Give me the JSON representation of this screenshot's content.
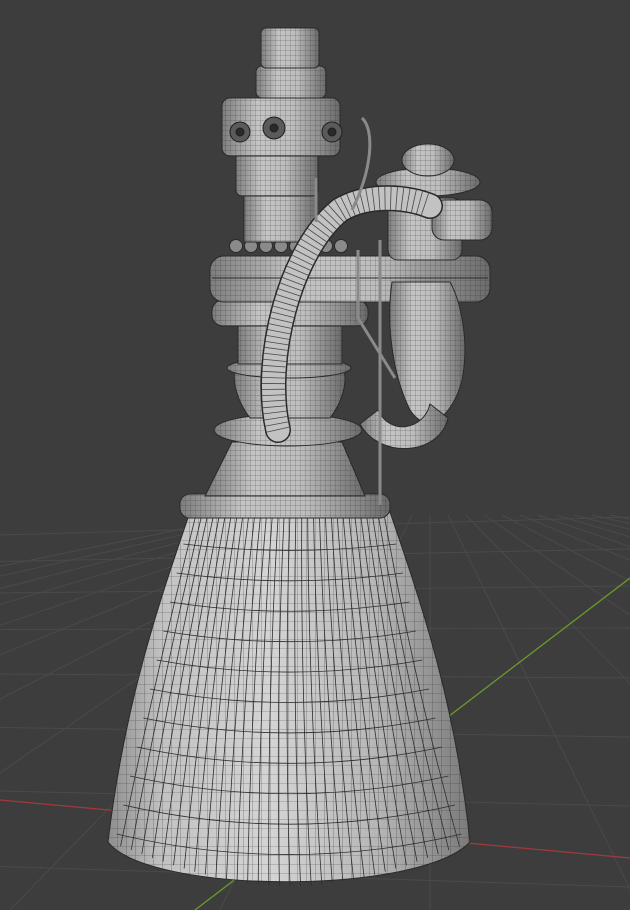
{
  "viewport": {
    "background": "#3d3d3d",
    "grid_color": "#4a4a4a",
    "x_axis_color": "#a33a3a",
    "y_axis_color": "#6b9a2a",
    "wire_color": "#2a2a2a",
    "surface_light": "#c9c9c9",
    "surface_mid": "#a8a8a8",
    "surface_dark": "#6e6e6e",
    "shading": "solid",
    "overlay": "wireframe",
    "grid": true
  },
  "object": {
    "icon": "rocket-engine-icon"
  }
}
